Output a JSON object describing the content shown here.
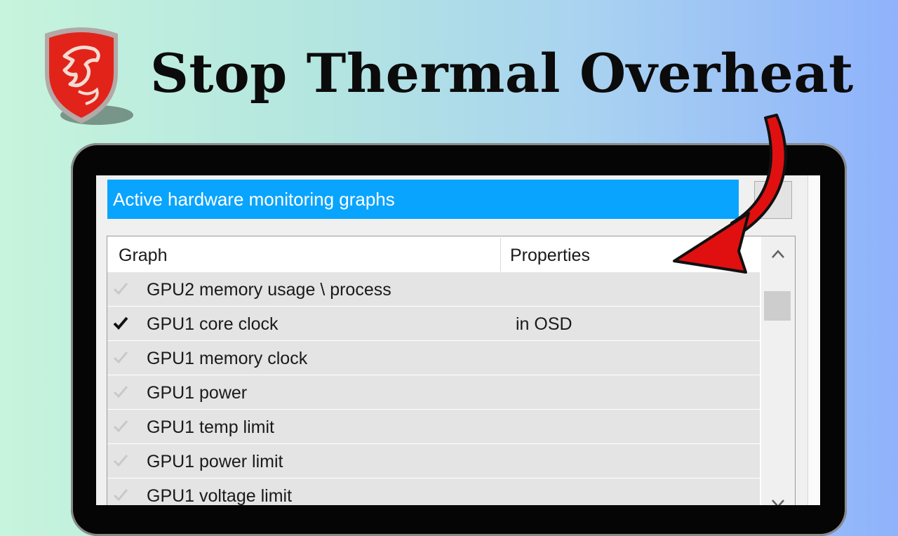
{
  "headline": "Stop Thermal Overheat",
  "brand": {
    "logo": "msi-dragon-shield-logo",
    "logo_color": "#e2231a"
  },
  "window": {
    "header_title": "Active hardware monitoring graphs",
    "header_color": "#09a4fd"
  },
  "table": {
    "columns": {
      "graph": "Graph",
      "properties": "Properties"
    },
    "rows": [
      {
        "name": "GPU2 memory usage \\ process",
        "property": "",
        "checked": false
      },
      {
        "name": "GPU1 core clock",
        "property": "in OSD",
        "checked": true
      },
      {
        "name": "GPU1 memory clock",
        "property": "",
        "checked": false
      },
      {
        "name": "GPU1 power",
        "property": "",
        "checked": false
      },
      {
        "name": "GPU1 temp limit",
        "property": "",
        "checked": false
      },
      {
        "name": "GPU1 power limit",
        "property": "",
        "checked": false
      },
      {
        "name": "GPU1 voltage limit",
        "property": "",
        "checked": false
      }
    ]
  },
  "annotation": {
    "icon": "red-curved-arrow-icon",
    "color": "#e01010"
  }
}
